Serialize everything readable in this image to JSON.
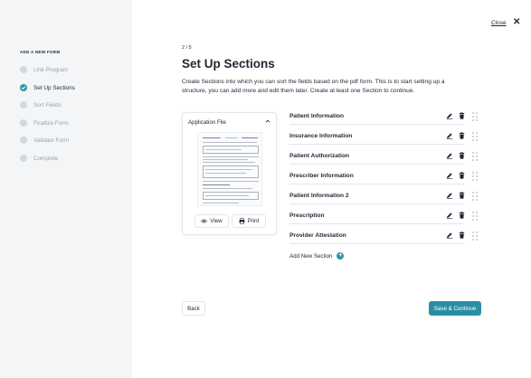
{
  "sidebar": {
    "title": "ADD A NEW FORM",
    "steps": [
      {
        "label": "Link Program",
        "state": "pending"
      },
      {
        "label": "Set Up Sections",
        "state": "active"
      },
      {
        "label": "Sort Fields",
        "state": "pending"
      },
      {
        "label": "Finalize Form",
        "state": "pending"
      },
      {
        "label": "Validate Form",
        "state": "pending"
      },
      {
        "label": "Complete",
        "state": "pending"
      }
    ]
  },
  "header": {
    "close_label": "Close",
    "close_icon": "✕"
  },
  "main": {
    "step_count": "2 / 5",
    "title": "Set Up Sections",
    "description": "Create Sections into which you can sort the fields based on the pdf form. This is to start setting up a structure, you can add more and edit them later. Create at least one Section to continue."
  },
  "file_card": {
    "title": "Application File",
    "view_label": "View",
    "print_label": "Print"
  },
  "sections": [
    {
      "name": "Patient Information"
    },
    {
      "name": "Insurance Information"
    },
    {
      "name": "Patient Authorization"
    },
    {
      "name": "Prescriber Information"
    },
    {
      "name": "Patient Information 2"
    },
    {
      "name": "Prescription"
    },
    {
      "name": "Provider Attestation"
    }
  ],
  "add_section_label": "Add New Section",
  "footer": {
    "back_label": "Back",
    "save_label": "Save & Continue"
  },
  "colors": {
    "accent": "#2a96a8",
    "primary_button": "#2a8fa5",
    "sidebar_bg": "#f4f5f7"
  }
}
